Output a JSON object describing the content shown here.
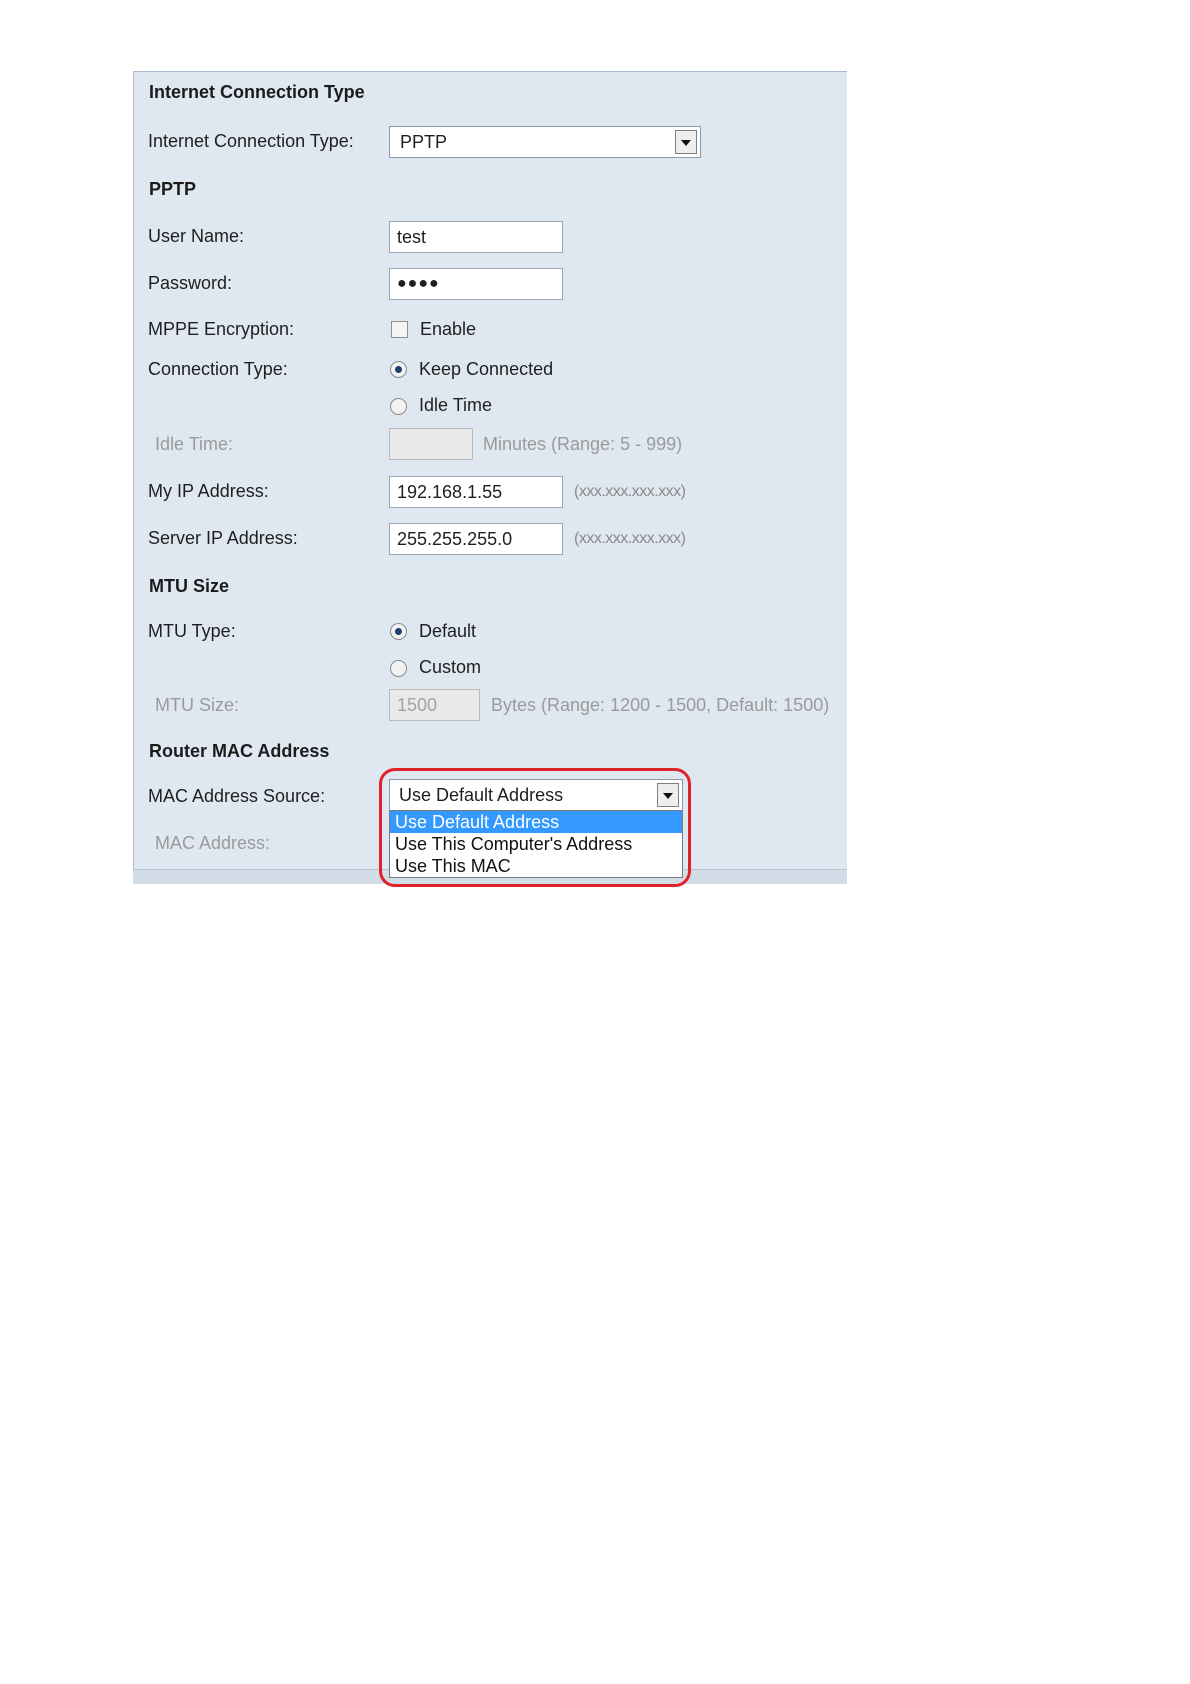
{
  "sections": {
    "connection": {
      "title": "Internet Connection Type",
      "type_label": "Internet Connection Type:",
      "type_value": "PPTP"
    },
    "pptp": {
      "title": "PPTP",
      "username_label": "User Name:",
      "username_value": "test",
      "password_label": "Password:",
      "password_value": "●●●●",
      "mppe_label": "MPPE Encryption:",
      "mppe_option": "Enable",
      "mppe_checked": false,
      "conn_type_label": "Connection Type:",
      "keep_connected": "Keep Connected",
      "idle_time_option": "Idle Time",
      "selected_conn_type": "Keep Connected",
      "idle_time_label": "Idle Time:",
      "idle_time_value": "",
      "idle_time_hint": "Minutes (Range: 5 - 999)",
      "my_ip_label": "My IP Address:",
      "my_ip_value": "192.168.1.55",
      "ip_format_hint": "(xxx.xxx.xxx.xxx)",
      "server_ip_label": "Server IP Address:",
      "server_ip_value": "255.255.255.0"
    },
    "mtu": {
      "title": "MTU Size",
      "type_label": "MTU Type:",
      "default_option": "Default",
      "custom_option": "Custom",
      "selected": "Default",
      "size_label": "MTU Size:",
      "size_value": "1500",
      "size_hint": "Bytes (Range: 1200 - 1500, Default: 1500)"
    },
    "mac": {
      "title": "Router MAC Address",
      "source_label": "MAC Address Source:",
      "source_value": "Use Default Address",
      "options": [
        "Use Default Address",
        "Use This Computer's Address",
        "Use This MAC"
      ],
      "highlighted_option": "Use Default Address",
      "address_label": "MAC Address:"
    }
  },
  "colors": {
    "panel_bg": "#dfe8f1",
    "highlight_ring": "#e0222b",
    "selected_option": "#3399ff"
  }
}
